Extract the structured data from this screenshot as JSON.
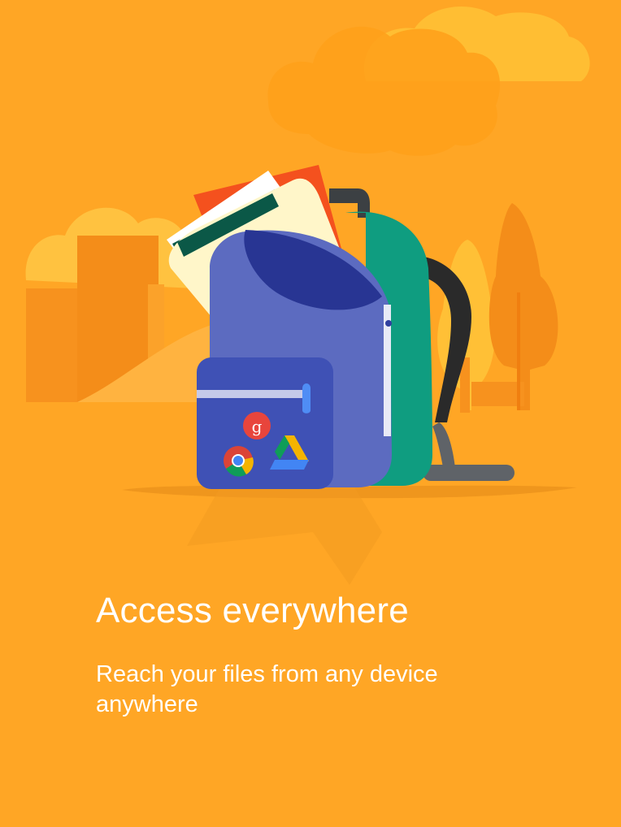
{
  "onboarding": {
    "title": "Access everywhere",
    "subtitle": "Reach your files from any device anywhere"
  },
  "colors": {
    "background": "#FFA625",
    "text": "#FFFFFF",
    "backpack": "#5C6BC0",
    "backpack_pocket": "#3F51B5",
    "backpack_back": "#0F9D80"
  },
  "icons": [
    "google-plus-icon",
    "chrome-icon",
    "drive-icon"
  ]
}
